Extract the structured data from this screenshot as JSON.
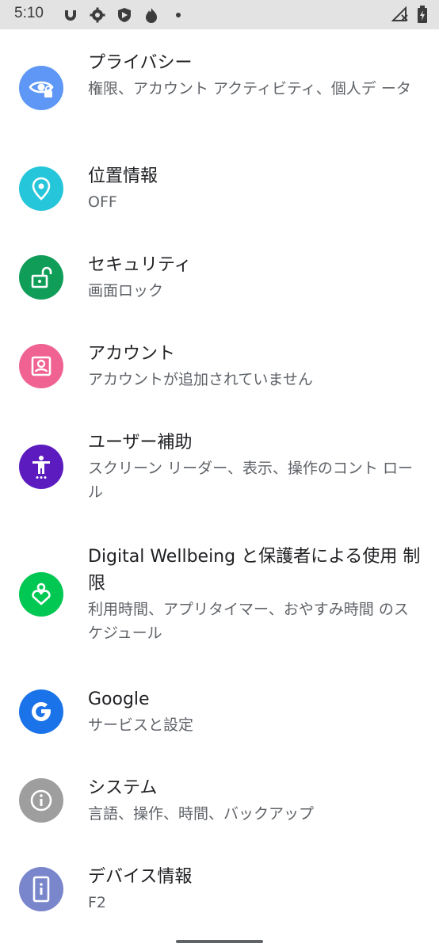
{
  "status_bar": {
    "time": "5:10",
    "icons": [
      "app-notification-icon",
      "settings-gear-icon",
      "shield-icon",
      "fire-icon",
      "dot-icon"
    ],
    "right_icons": [
      "no-signal-icon",
      "battery-charging-icon"
    ]
  },
  "settings": {
    "items": [
      {
        "title": "プライバシー",
        "subtitle": "権限、アカウント アクティビティ、個人デ ータ",
        "icon": "privacy-eye-icon",
        "color": "#5e97f6"
      },
      {
        "title": "位置情報",
        "subtitle": "OFF",
        "icon": "location-pin-icon",
        "color": "#26c6da"
      },
      {
        "title": "セキュリティ",
        "subtitle": "画面ロック",
        "icon": "unlock-icon",
        "color": "#0f9d58"
      },
      {
        "title": "アカウント",
        "subtitle": "アカウントが追加されていません",
        "icon": "account-box-icon",
        "color": "#f06292"
      },
      {
        "title": "ユーザー補助",
        "subtitle": "スクリーン リーダー、表示、操作のコント ロール",
        "icon": "accessibility-icon",
        "color": "#5b1bbf"
      },
      {
        "title": "Digital Wellbeing と保護者による使用 制限",
        "subtitle": "利用時間、アプリタイマー、おやすみ時間 のスケジュール",
        "icon": "wellbeing-heart-icon",
        "color": "#00c853"
      },
      {
        "title": "Google",
        "subtitle": "サービスと設定",
        "icon": "google-g-icon",
        "color": "#1a73e8"
      },
      {
        "title": "システム",
        "subtitle": "言語、操作、時間、バックアップ",
        "icon": "info-icon",
        "color": "#9e9e9e"
      },
      {
        "title": "デバイス情報",
        "subtitle": "F2",
        "icon": "device-phone-icon",
        "color": "#7986cb"
      }
    ]
  }
}
